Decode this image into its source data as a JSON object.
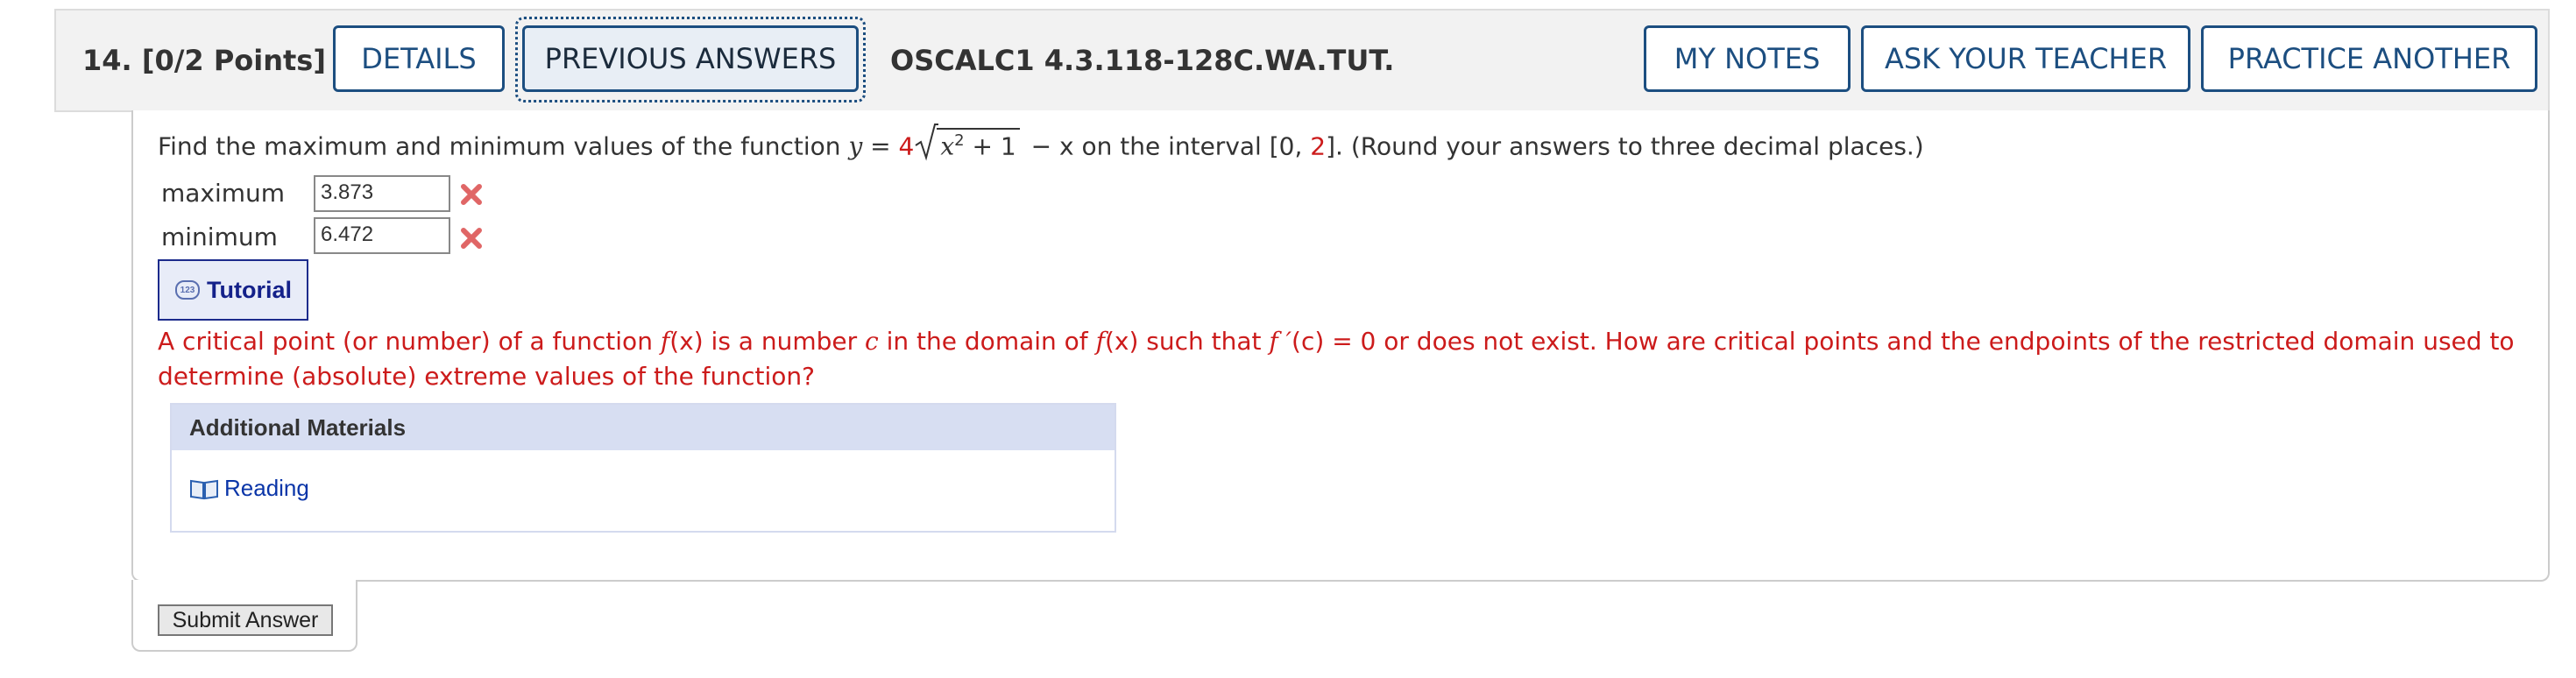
{
  "header": {
    "question_number": "14.",
    "points": "[0/2 Points]",
    "buttons": {
      "details": "DETAILS",
      "previous_answers": "PREVIOUS ANSWERS",
      "my_notes": "MY NOTES",
      "ask_teacher": "ASK YOUR TEACHER",
      "practice_another": "PRACTICE ANOTHER"
    },
    "problem_code": "OSCALC1 4.3.118-128C.WA.TUT."
  },
  "question": {
    "prefix": "Find the maximum and minimum values of the function ",
    "y": "y",
    "equals": " = ",
    "coef": "4",
    "radicand_x": "x",
    "radicand_exp": "2",
    "radicand_rest": " + 1",
    "minus_x": " − x",
    "interval_prefix": " on the interval [0, ",
    "interval_end": "2",
    "suffix": "]. (Round your answers to three decimal places.)"
  },
  "answers": {
    "maximum_label": "maximum",
    "maximum_value": "3.873",
    "minimum_label": "minimum",
    "minimum_value": "6.472"
  },
  "tutorial": {
    "icon_text": "123",
    "label": "Tutorial"
  },
  "hint": {
    "p1": "A critical point (or number) of a function ",
    "f1": "f",
    "x1": "(x)",
    "p2": " is a number ",
    "c1": "c",
    "p3": " in the domain of ",
    "f2": "f",
    "x2": "(x)",
    "p4": " such that ",
    "fprime": "f ′",
    "p5": "(c) = 0 or does not exist. How are critical points and the endpoints of the restricted domain used to determine (absolute) extreme values of the function?"
  },
  "materials": {
    "heading": "Additional Materials",
    "reading_label": "Reading"
  },
  "submit_label": "Submit Answer",
  "colors": {
    "accent": "#1c4e80",
    "error_red": "#cc1b1b",
    "link_blue": "#0a35a8"
  }
}
